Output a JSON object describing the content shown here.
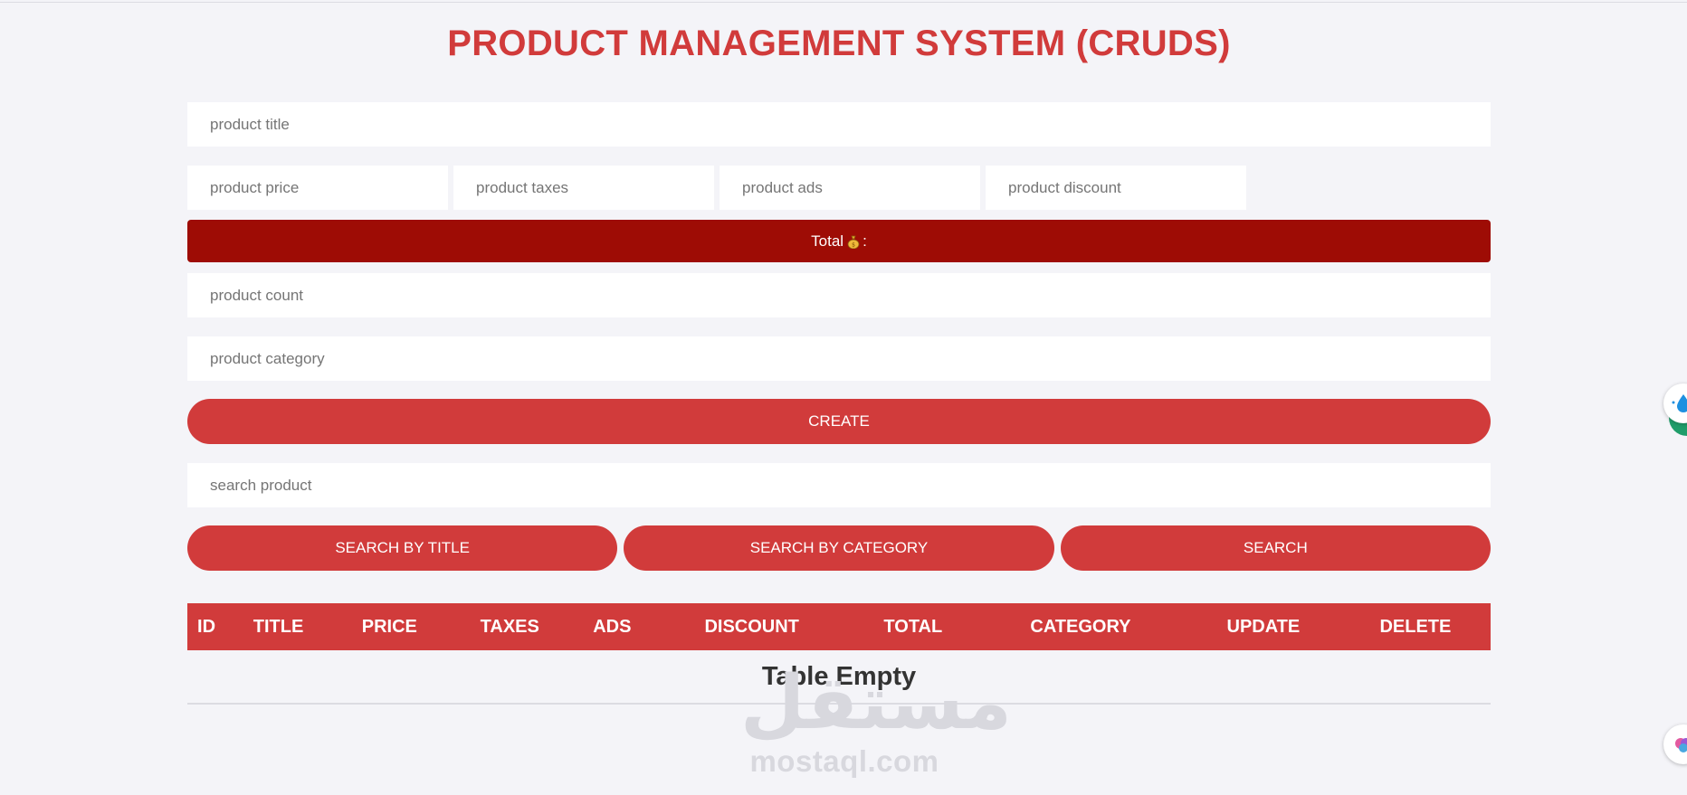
{
  "header": {
    "title": "PRODUCT MANAGEMENT SYSTEM (CRUDS)"
  },
  "form": {
    "title_placeholder": "product title",
    "price_placeholder": "product price",
    "taxes_placeholder": "product taxes",
    "ads_placeholder": "product ads",
    "discount_placeholder": "product discount",
    "total_label": "Total",
    "total_suffix": ":",
    "total_icon": "money-bag-icon",
    "count_placeholder": "product count",
    "category_placeholder": "product category",
    "create_label": "CREATE"
  },
  "search": {
    "placeholder": "search product",
    "by_title_label": "SEARCH BY TITLE",
    "by_category_label": "SEARCH BY CATEGORY",
    "search_label": "SEARCH"
  },
  "table": {
    "columns": [
      "ID",
      "TITLE",
      "PRICE",
      "TAXES",
      "ADS",
      "DISCOUNT",
      "TOTAL",
      "CATEGORY",
      "UPDATE",
      "DELETE"
    ],
    "empty_message": "Table Empty"
  },
  "watermark": {
    "arabic": "مستقل",
    "latin": "mostaql.com"
  },
  "floating_widgets": [
    "water-drop-icon",
    "brain-icon"
  ],
  "colors": {
    "accent": "#d13b3b",
    "total_bar": "#9e0c05",
    "background": "#f4f4f8"
  }
}
